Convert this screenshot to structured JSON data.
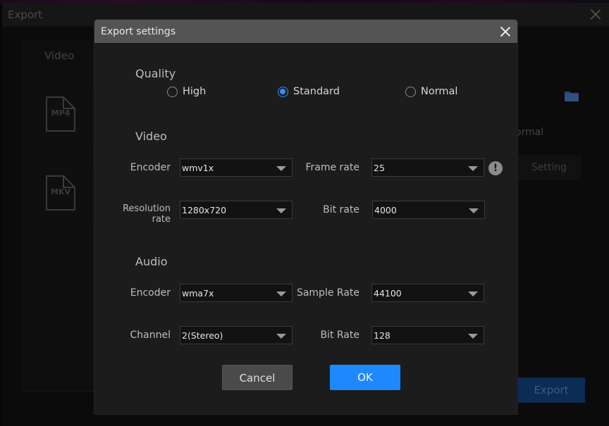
{
  "background_window": {
    "title": "Export",
    "tab_label": "Video",
    "formats": [
      {
        "label": "MP4",
        "icon": "file-mp4-icon"
      },
      {
        "label": "MKV",
        "icon": "file-mkv-icon"
      }
    ],
    "partial_quality_label": "ormal",
    "setting_button": "Setting",
    "export_button": "Export"
  },
  "dialog": {
    "title": "Export settings",
    "quality": {
      "title": "Quality",
      "options": [
        {
          "label": "High",
          "checked": false
        },
        {
          "label": "Standard",
          "checked": true
        },
        {
          "label": "Normal",
          "checked": false
        }
      ]
    },
    "video": {
      "title": "Video",
      "encoder": {
        "label": "Encoder",
        "value": "wmv1x"
      },
      "frame_rate": {
        "label": "Frame rate",
        "value": "25"
      },
      "resolution": {
        "label": "Resolution rate",
        "value": "1280x720"
      },
      "bit_rate": {
        "label": "Bit rate",
        "value": "4000"
      }
    },
    "audio": {
      "title": "Audio",
      "encoder": {
        "label": "Encoder",
        "value": "wma7x"
      },
      "sample_rate": {
        "label": "Sample Rate",
        "value": "44100"
      },
      "channel": {
        "label": "Channel",
        "value": "2(Stereo)"
      },
      "bit_rate": {
        "label": "Bit Rate",
        "value": "128"
      }
    },
    "warning_glyph": "!",
    "cancel_label": "Cancel",
    "ok_label": "OK"
  },
  "colors": {
    "accent": "#1e88ff",
    "dialog_bg": "#1c1c1c",
    "titlebar_bg": "#545454"
  }
}
